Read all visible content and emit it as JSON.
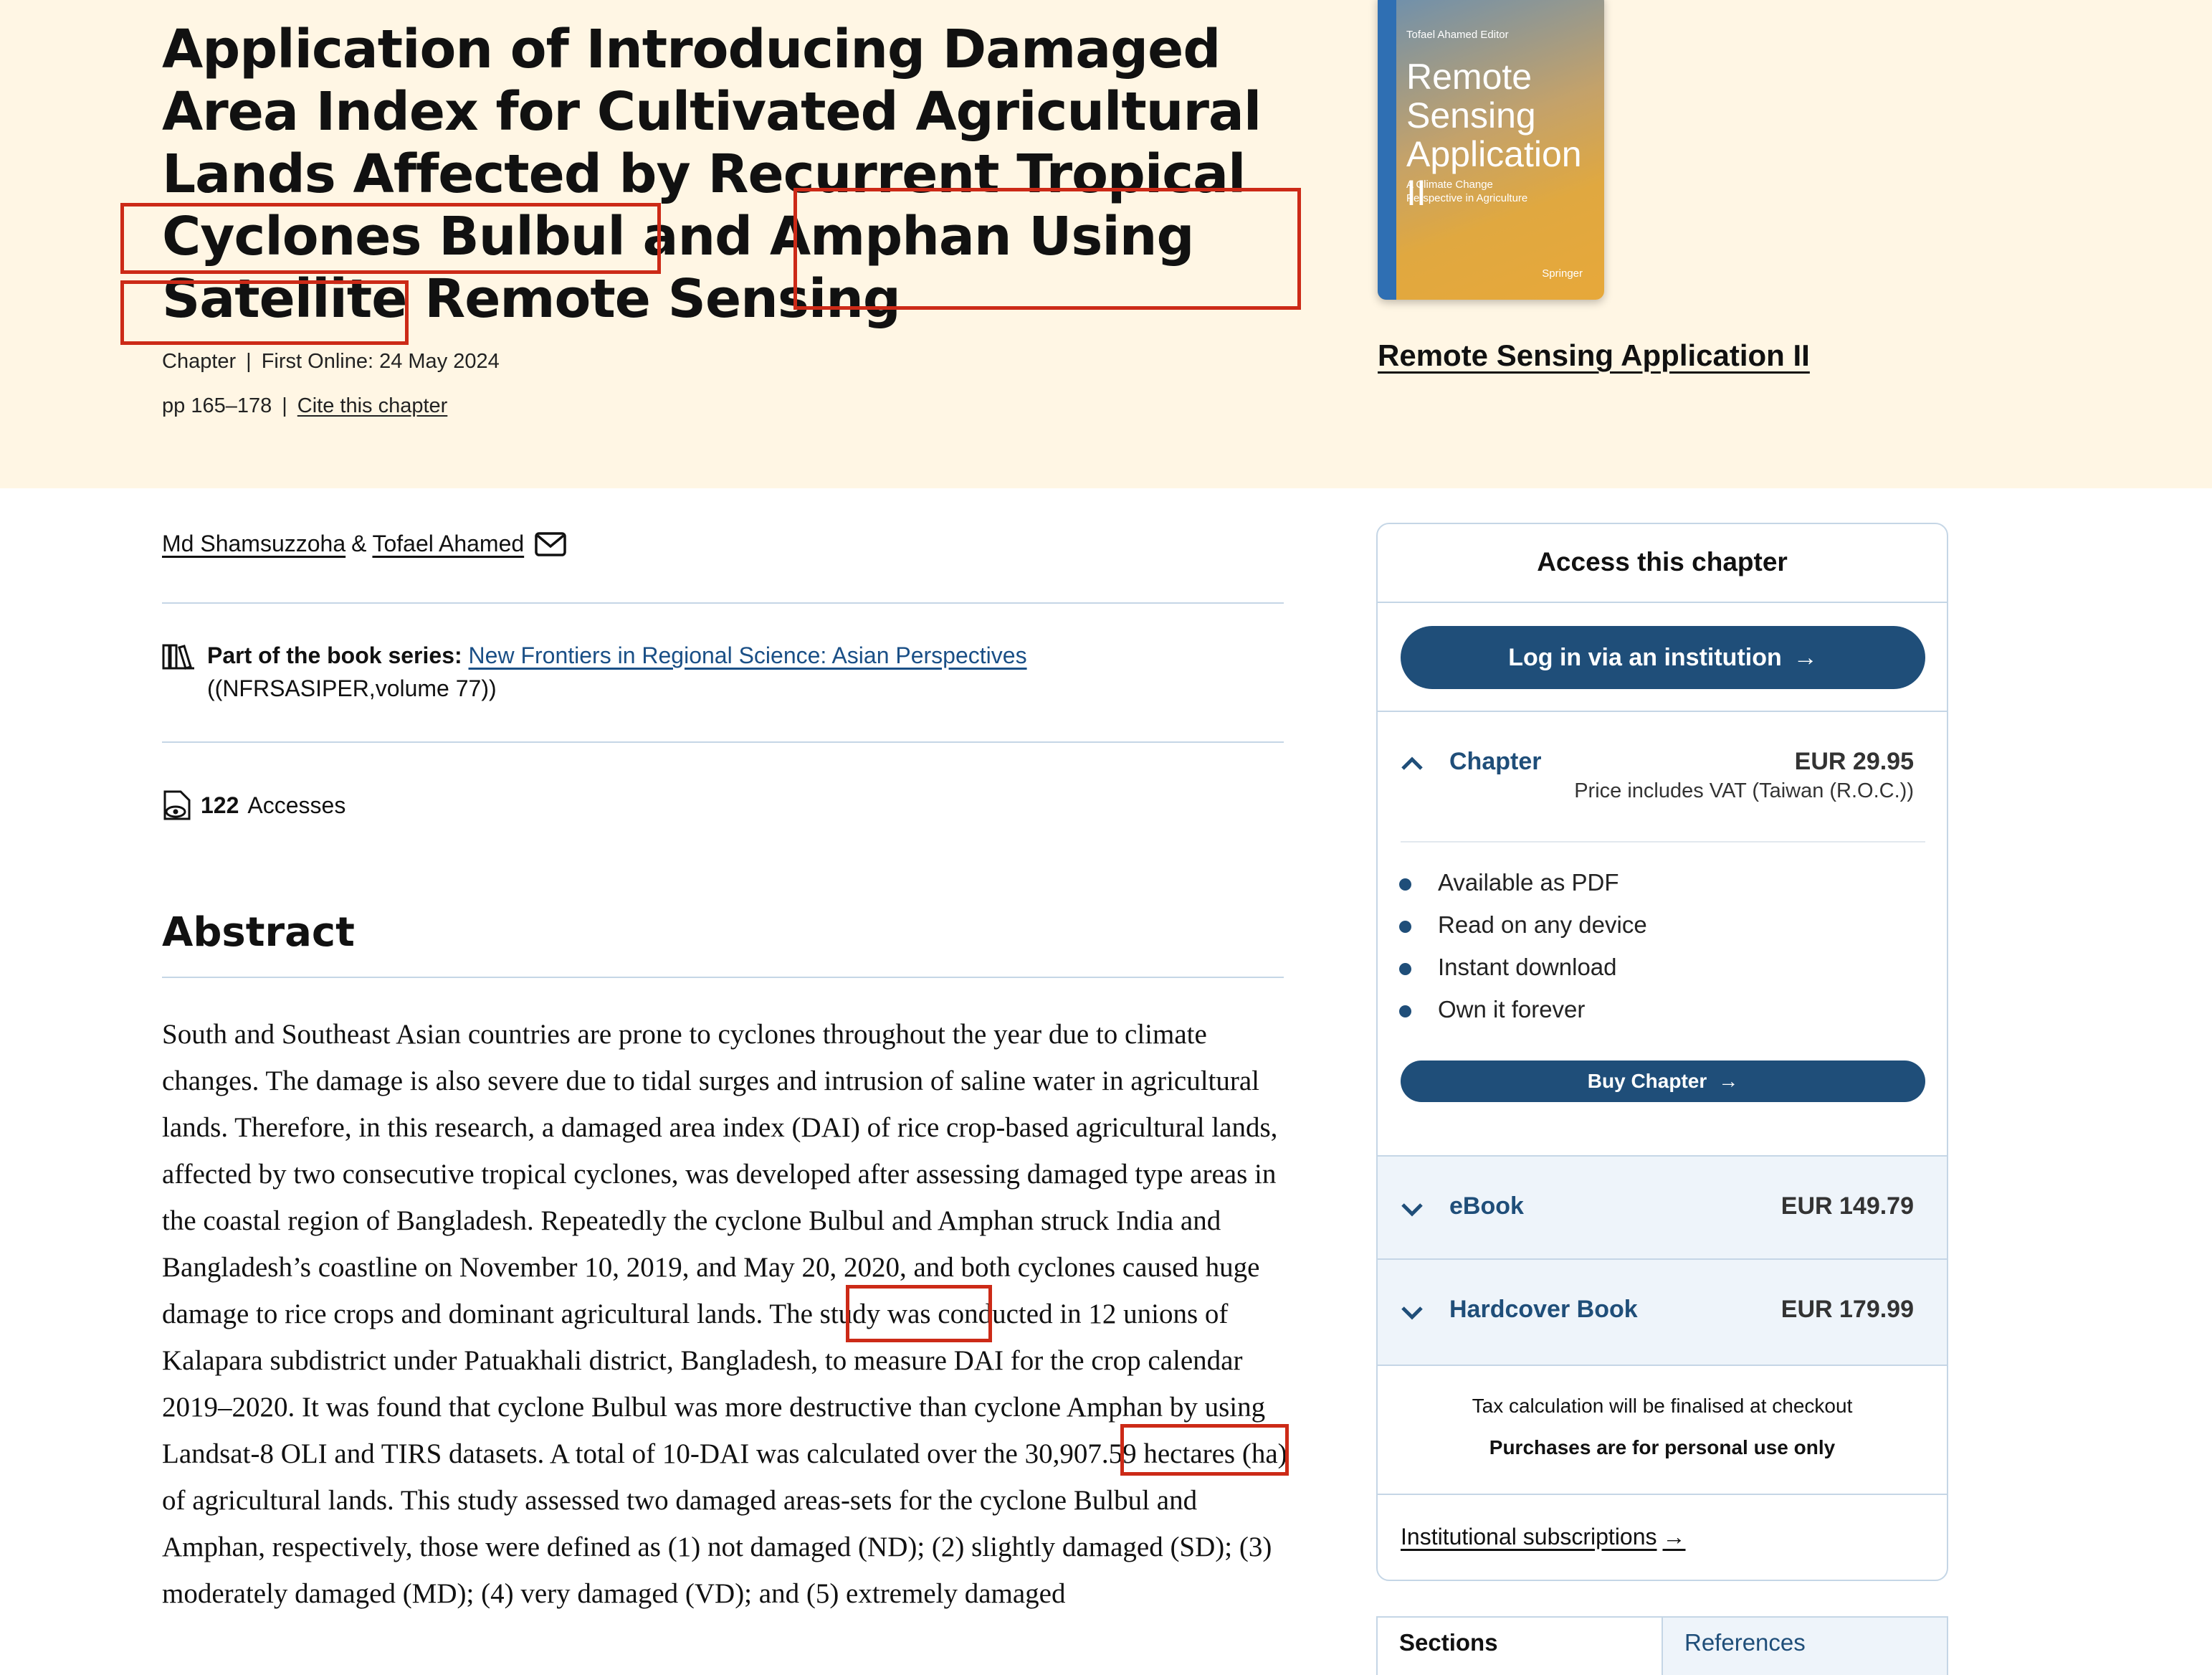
{
  "header": {
    "title": "Application of Introducing Damaged Area Index for Cultivated Agricultural Lands Affected by Recurrent Tropical Cyclones Bulbul and Amphan Using Satellite Remote Sensing",
    "type": "Chapter",
    "first_online": "First Online: 24 May 2024",
    "pages": "pp 165–178",
    "cite_link": "Cite this chapter"
  },
  "book": {
    "link": "Remote Sensing Application II",
    "cover_editor": "Tofael Ahamed  Editor",
    "cover_title": "Remote Sensing Application II",
    "cover_subtitle": "A Climate Change Perspective in Agriculture",
    "cover_publisher": "Springer"
  },
  "authors": {
    "first": "Md Shamsuzzoha",
    "separator": "&",
    "second": "Tofael Ahamed"
  },
  "series": {
    "label": "Part of the book series:",
    "name": "New Frontiers in Regional Science: Asian Perspectives",
    "volume": "((NFRSASIPER,volume 77))"
  },
  "metrics": {
    "accesses_count": "122",
    "accesses_label": "Accesses"
  },
  "abstract": {
    "heading": "Abstract",
    "text": "South and Southeast Asian countries are prone to cyclones throughout the year due to climate changes. The damage is also severe due to tidal surges and intrusion of saline water in agricultural lands. Therefore, in this research, a damaged area index (DAI) of rice crop-based agricultural lands, affected by two consecutive tropical cyclones, was developed after assessing damaged type areas in the coastal region of Bangladesh. Repeatedly the cyclone Bulbul and Amphan struck India and Bangladesh’s coastline on November 10, 2019, and May 20, 2020, and both cyclones caused huge damage to rice crops and dominant agricultural lands. The study was conducted in 12 unions of Kalapara subdistrict under Patuakhali district, Bangladesh, to measure DAI for the crop calendar 2019–2020. It was found that cyclone Bulbul was more destructive than cyclone Amphan by using Landsat-8 OLI and TIRS datasets. A total of 10-DAI was calculated over the 30,907.59 hectares (ha) of agricultural lands. This study assessed two damaged areas-sets for the cyclone Bulbul and Amphan, respectively, those were defined as (1) not damaged (ND); (2) slightly damaged (SD); (3) moderately damaged (MD); (4) very damaged (VD); and (5) extremely damaged"
  },
  "access_panel": {
    "heading": "Access this chapter",
    "login_button": "Log in via an institution",
    "chapter": {
      "label": "Chapter",
      "price": "EUR 29.95",
      "vat_note": "Price includes VAT (Taiwan (R.O.C.))"
    },
    "features": [
      "Available as PDF",
      "Read on any device",
      "Instant download",
      "Own it forever"
    ],
    "buy_button": "Buy Chapter",
    "ebook": {
      "label": "eBook",
      "price": "EUR 149.79"
    },
    "hardcover": {
      "label": "Hardcover Book",
      "price": "EUR 179.99"
    },
    "tax_note": "Tax calculation will be finalised at checkout",
    "personal_use": "Purchases are for personal use only",
    "institutional_link": "Institutional subscriptions"
  },
  "tabs": {
    "sections": "Sections",
    "references": "References"
  },
  "colors": {
    "hero_bg": "#fff6e4",
    "accent": "#1f4e79",
    "highlight_box": "#cc2a17",
    "link": "#1a4f86"
  }
}
